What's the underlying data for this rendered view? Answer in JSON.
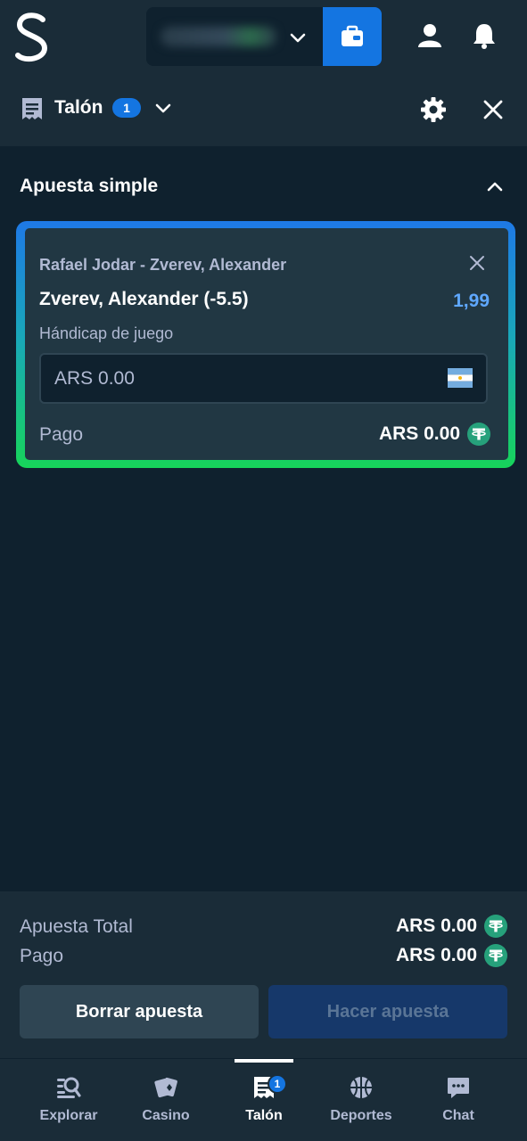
{
  "header": {
    "logo": "S",
    "icons": [
      "wallet-chevron-icon",
      "wallet-icon",
      "user-icon",
      "bell-icon"
    ]
  },
  "betslip": {
    "title": "Talón",
    "count": "1"
  },
  "section": {
    "title": "Apuesta simple"
  },
  "bet": {
    "match": "Rafael Jodar - Zverev, Alexander",
    "selection": "Zverev, Alexander (-5.5)",
    "odds": "1,99",
    "market": "Hándicap de juego",
    "stake_value": "ARS 0.00",
    "payout_label": "Pago",
    "payout_value": "ARS 0.00"
  },
  "summary": {
    "total_label": "Apuesta Total",
    "total_value": "ARS 0.00",
    "payout_label": "Pago",
    "payout_value": "ARS 0.00",
    "clear_button": "Borrar apuesta",
    "place_button": "Hacer apuesta"
  },
  "nav": {
    "items": [
      {
        "label": "Explorar"
      },
      {
        "label": "Casino"
      },
      {
        "label": "Talón",
        "badge": "1"
      },
      {
        "label": "Deportes"
      },
      {
        "label": "Chat"
      }
    ]
  },
  "colors": {
    "background": "#0f212e",
    "panel": "#1a2c38",
    "card": "#213743",
    "accent_blue": "#1475e1",
    "odds_blue": "#5fa8ff",
    "tether_green": "#26a17b"
  }
}
